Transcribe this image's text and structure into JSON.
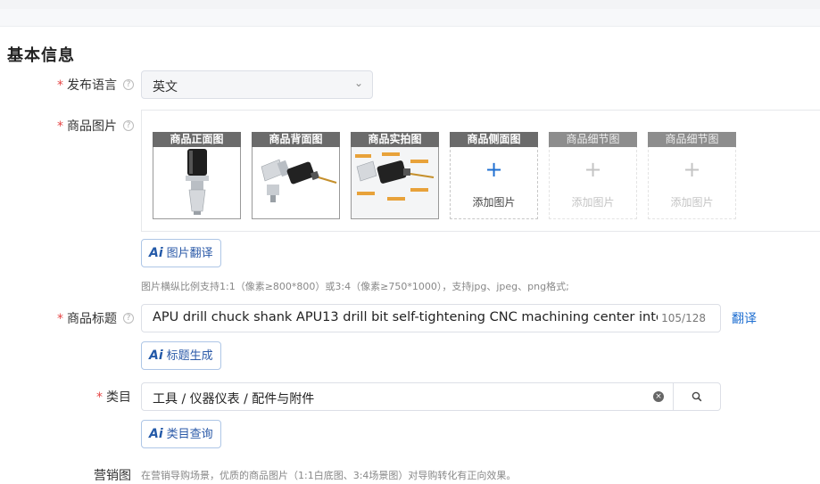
{
  "section_title": "基本信息",
  "language": {
    "label": "发布语言",
    "value": "英文"
  },
  "images": {
    "label": "商品图片",
    "slots": [
      {
        "caption": "商品正面图",
        "state": "filled"
      },
      {
        "caption": "商品背面图",
        "state": "filled"
      },
      {
        "caption": "商品实拍图",
        "state": "filled"
      },
      {
        "caption": "商品侧面图",
        "state": "empty",
        "add_label": "添加图片"
      },
      {
        "caption": "商品细节图",
        "state": "disabled",
        "add_label": "添加图片"
      },
      {
        "caption": "商品细节图",
        "state": "disabled",
        "add_label": "添加图片"
      }
    ],
    "translate_button": "图片翻译",
    "hint": "图片横纵比例支持1:1（像素≥800*800）或3:4（像素≥750*1000），支持jpg、jpeg、png格式;"
  },
  "title": {
    "label": "商品标题",
    "value": "APU drill chuck shank APU13 drill bit self-tightening CNC machining center integrated",
    "count": "105/128",
    "translate_link": "翻译",
    "generate_button": "标题生成"
  },
  "category": {
    "label": "类目",
    "value": "工具 / 仪器仪表 / 配件与附件",
    "query_button": "类目查询"
  },
  "marketing": {
    "label": "营销图",
    "hint": "在营销导购场景，优质的商品图片（1:1白底图、3:4场景图）对导购转化有正向效果。"
  },
  "ai_badge": "Ai",
  "colors": {
    "required": "#e54545",
    "link": "#1f6fd1",
    "ai_border": "#aec6e6"
  }
}
